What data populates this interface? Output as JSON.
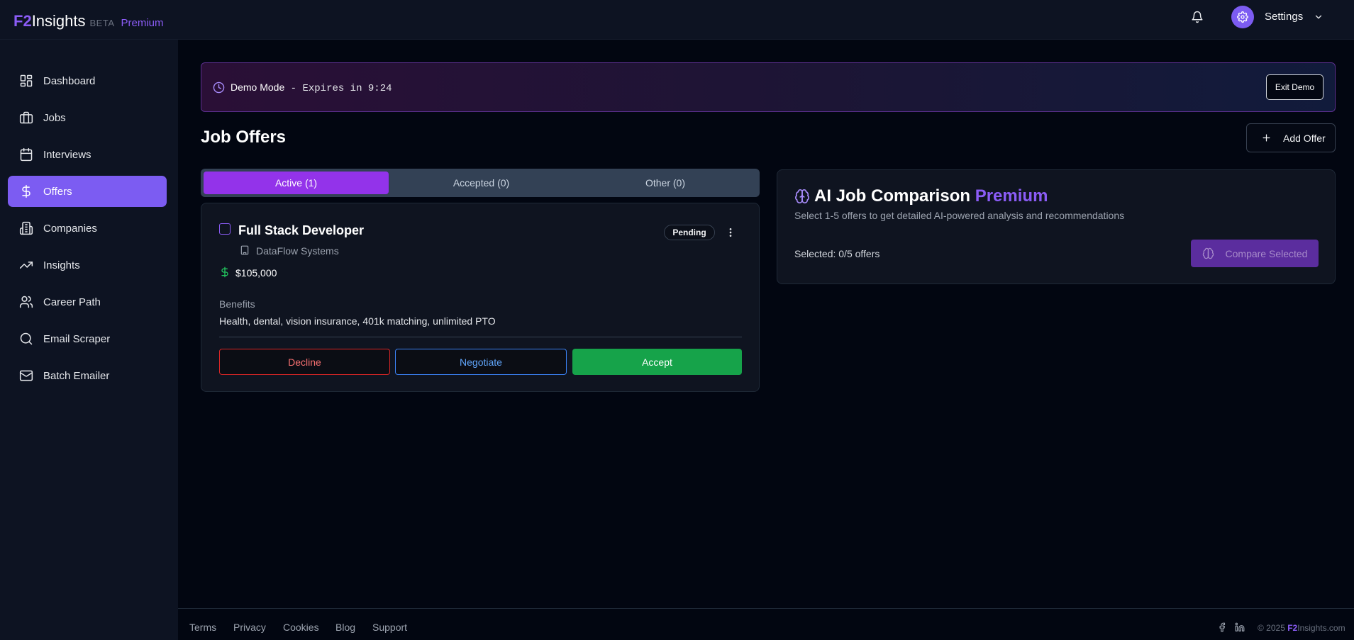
{
  "brand": {
    "f2": "F2",
    "insights": "Insights",
    "beta": "BETA",
    "premium": "Premium"
  },
  "header": {
    "settings_label": "Settings"
  },
  "sidebar": {
    "items": [
      {
        "label": "Dashboard",
        "icon": "dashboard-icon"
      },
      {
        "label": "Jobs",
        "icon": "briefcase-icon"
      },
      {
        "label": "Interviews",
        "icon": "calendar-icon"
      },
      {
        "label": "Offers",
        "icon": "dollar-icon",
        "active": true
      },
      {
        "label": "Companies",
        "icon": "building-icon"
      },
      {
        "label": "Insights",
        "icon": "trending-up-icon"
      },
      {
        "label": "Career Path",
        "icon": "users-icon"
      },
      {
        "label": "Email Scraper",
        "icon": "search-icon"
      },
      {
        "label": "Batch Emailer",
        "icon": "mail-icon"
      }
    ]
  },
  "demo": {
    "mode_label": "Demo Mode",
    "expires_text": " - Expires in 9:24",
    "exit_label": "Exit Demo"
  },
  "page": {
    "title": "Job Offers",
    "add_offer_label": "Add Offer"
  },
  "tabs": [
    {
      "label": "Active (1)",
      "active": true
    },
    {
      "label": "Accepted (0)"
    },
    {
      "label": "Other (0)"
    }
  ],
  "offer": {
    "title": "Full Stack Developer",
    "company": "DataFlow Systems",
    "status": "Pending",
    "salary": "$105,000",
    "benefits_label": "Benefits",
    "benefits": "Health, dental, vision insurance, 401k matching, unlimited PTO",
    "decline_label": "Decline",
    "negotiate_label": "Negotiate",
    "accept_label": "Accept"
  },
  "ai_comparison": {
    "title": "AI Job Comparison",
    "premium": "Premium",
    "subtitle": "Select 1-5 offers to get detailed AI-powered analysis and recommendations",
    "selected": "Selected: 0/5 offers",
    "compare_label": "Compare Selected"
  },
  "footer": {
    "links": [
      "Terms",
      "Privacy",
      "Cookies",
      "Blog",
      "Support"
    ],
    "copyright_prefix": "© 2025 ",
    "copyright_f2": "F2",
    "copyright_suffix": "Insights.com"
  },
  "colors": {
    "accent": "#7c5cf2",
    "tab_active": "#9333ea",
    "accept": "#16a34a",
    "decline": "#dc2626",
    "negotiate": "#3b82f6",
    "background": "#020611",
    "sidebar": "#0d1322"
  }
}
